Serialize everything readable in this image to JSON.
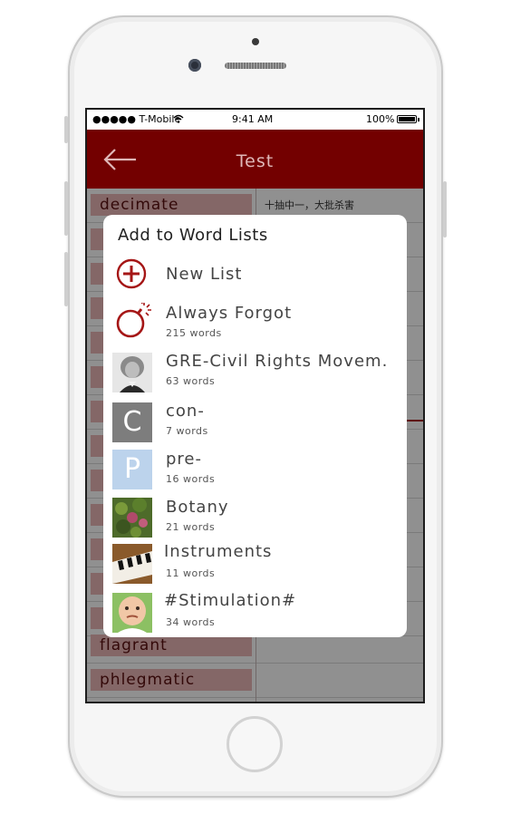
{
  "status_bar": {
    "carrier": "●●●●● T-Mobile",
    "time": "9:41 AM",
    "battery": "100%"
  },
  "nav": {
    "title": "Test"
  },
  "words": [
    "decimate",
    "",
    "",
    "",
    "",
    "",
    "",
    "",
    "",
    "",
    "",
    "",
    "",
    "flagrant",
    "phlegmatic"
  ],
  "definition": "十抽中一，大批杀害",
  "dialog": {
    "title": "Add to Word Lists",
    "new_list": "New List",
    "lists": [
      {
        "name": "Always Forgot",
        "count": "215 words",
        "icon": "bomb-icon"
      },
      {
        "name": "GRE-Civil Rights Movem.",
        "count": "63 words",
        "icon": "portrait-thumbnail"
      },
      {
        "name": "con-",
        "count": "7 words",
        "icon": "letter-c-thumbnail",
        "letter": "C",
        "color": "#7d7d7d"
      },
      {
        "name": "pre-",
        "count": "16 words",
        "icon": "letter-p-thumbnail",
        "letter": "P",
        "color": "#bcd3ec"
      },
      {
        "name": "Botany",
        "count": "21 words",
        "icon": "botany-thumbnail"
      },
      {
        "name": "Instruments",
        "count": "11 words",
        "icon": "piano-thumbnail"
      },
      {
        "name": "#Stimulation#",
        "count": "34 words",
        "icon": "baby-thumbnail"
      }
    ]
  },
  "colors": {
    "brand": "#730000",
    "accent": "#a51616",
    "word_tag": "#e9b5b5"
  }
}
